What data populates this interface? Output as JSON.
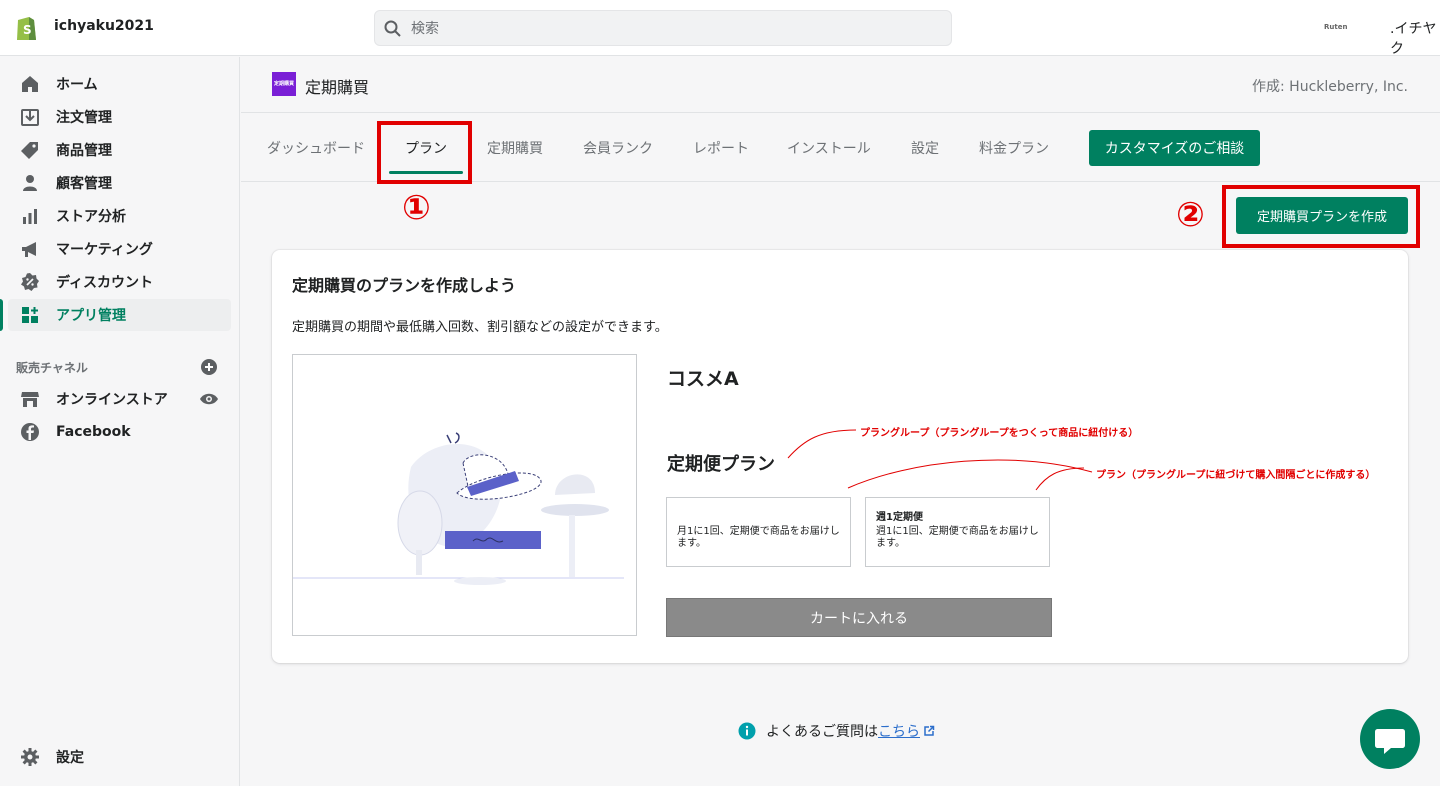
{
  "topbar": {
    "store_name": "ichyaku2021",
    "search_placeholder": "検索",
    "ruten_label": "Ruten",
    "store_right": ".イチヤク"
  },
  "sidebar": {
    "items": [
      {
        "label": "ホーム",
        "icon": "home-icon"
      },
      {
        "label": "注文管理",
        "icon": "orders-icon"
      },
      {
        "label": "商品管理",
        "icon": "tag-icon"
      },
      {
        "label": "顧客管理",
        "icon": "person-icon"
      },
      {
        "label": "ストア分析",
        "icon": "bar-chart-icon"
      },
      {
        "label": "マーケティング",
        "icon": "megaphone-icon"
      },
      {
        "label": "ディスカウント",
        "icon": "discount-icon"
      },
      {
        "label": "アプリ管理",
        "icon": "apps-icon",
        "active": true
      }
    ],
    "channels_title": "販売チャネル",
    "channels": [
      {
        "label": "オンラインストア",
        "icon": "store-icon"
      },
      {
        "label": "Facebook",
        "icon": "facebook-icon"
      }
    ],
    "settings_label": "設定"
  },
  "app": {
    "icon_text": "定期購買",
    "title": "定期購買",
    "author": "作成: Huckleberry, Inc."
  },
  "tabs": [
    {
      "label": "ダッシュボード"
    },
    {
      "label": "プラン",
      "active": true
    },
    {
      "label": "定期購買"
    },
    {
      "label": "会員ランク"
    },
    {
      "label": "レポート"
    },
    {
      "label": "インストール"
    },
    {
      "label": "設定"
    },
    {
      "label": "料金プラン"
    }
  ],
  "consult_button": "カスタマイズのご相談",
  "create_button": "定期購買プランを作成",
  "annotations": {
    "one": "①",
    "two": "②"
  },
  "card": {
    "title": "定期購買のプランを作成しよう",
    "desc": "定期購買の期間や最低購入回数、割引額などの設定ができます。",
    "preview_title": "コスメA",
    "group_name": "定期便プラン",
    "plans": [
      {
        "title": "",
        "desc": "月1に1回、定期便で商品をお届けします。"
      },
      {
        "title": "週1定期便",
        "desc": "週1に1回、定期便で商品をお届けします。"
      }
    ],
    "cart_button": "カートに入れる",
    "note_group": "プラングループ（プラングループをつくって商品に紐付ける）",
    "note_plan": "プラン（プラングループに紐づけて購入間隔ごとに作成する）"
  },
  "faq": {
    "text": "よくあるご質問は",
    "link": "こちら"
  },
  "colors": {
    "accent": "#008060",
    "annotation": "#e10000",
    "app_icon": "#7a1fd6"
  }
}
